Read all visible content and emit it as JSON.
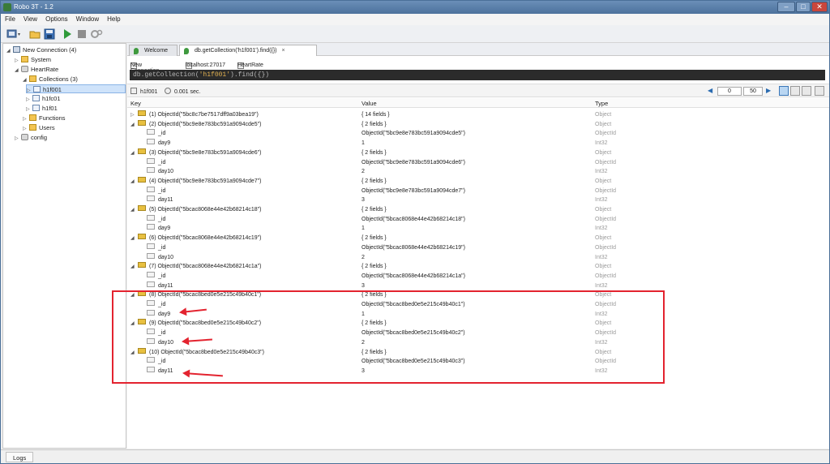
{
  "window": {
    "title": "Robo 3T - 1.2"
  },
  "menu": [
    "File",
    "View",
    "Options",
    "Window",
    "Help"
  ],
  "sidebar": {
    "items": [
      {
        "label": "New Connection (4)",
        "icon": "server-icon"
      },
      {
        "label": "System",
        "icon": "folder-icon"
      },
      {
        "label": "HeartRate",
        "icon": "database-icon"
      },
      {
        "label": "Collections (3)",
        "icon": "folder-icon"
      },
      {
        "label": "h1f001",
        "icon": "collection-icon"
      },
      {
        "label": "h1fc01",
        "icon": "collection-icon"
      },
      {
        "label": "h1f01",
        "icon": "collection-icon"
      },
      {
        "label": "Functions",
        "icon": "folder-icon"
      },
      {
        "label": "Users",
        "icon": "folder-icon"
      },
      {
        "label": "config",
        "icon": "database-icon"
      }
    ]
  },
  "tabs": [
    {
      "label": "Welcome"
    },
    {
      "label": "db.getCollection('h1f001').find({})",
      "close": "×"
    }
  ],
  "connection": {
    "name": "New Connection",
    "host": "localhost:27017",
    "db": "HeartRate"
  },
  "query": {
    "prefix": "db.getCollection(",
    "arg": "'h1f001'",
    "suffix": ").find({})"
  },
  "results": {
    "collection": "h1f001",
    "time": "0.001 sec.",
    "page_start": "0",
    "page_size": "50",
    "columns": {
      "key": "Key",
      "value": "Value",
      "type": "Type"
    },
    "rows": [
      {
        "level": 0,
        "expanded": false,
        "icon": "doc",
        "key": "(1) ObjectId(\"5bc8c7be7517dff9a03bea19\")",
        "value": "{ 14 fields }",
        "type": "Object"
      },
      {
        "level": 0,
        "expanded": true,
        "icon": "doc",
        "key": "(2) ObjectId(\"5bc9e8e783bc591a9094cde5\")",
        "value": "{ 2 fields }",
        "type": "Object"
      },
      {
        "level": 1,
        "icon": "oid",
        "key": "_id",
        "value": "ObjectId(\"5bc9e8e783bc591a9094cde5\")",
        "type": "ObjectId"
      },
      {
        "level": 1,
        "icon": "num",
        "key": "day9",
        "value": "1",
        "type": "Int32"
      },
      {
        "level": 0,
        "expanded": true,
        "icon": "doc",
        "key": "(3) ObjectId(\"5bc9e8e783bc591a9094cde6\")",
        "value": "{ 2 fields }",
        "type": "Object"
      },
      {
        "level": 1,
        "icon": "oid",
        "key": "_id",
        "value": "ObjectId(\"5bc9e8e783bc591a9094cde6\")",
        "type": "ObjectId"
      },
      {
        "level": 1,
        "icon": "num",
        "key": "day10",
        "value": "2",
        "type": "Int32"
      },
      {
        "level": 0,
        "expanded": true,
        "icon": "doc",
        "key": "(4) ObjectId(\"5bc9e8e783bc591a9094cde7\")",
        "value": "{ 2 fields }",
        "type": "Object"
      },
      {
        "level": 1,
        "icon": "oid",
        "key": "_id",
        "value": "ObjectId(\"5bc9e8e783bc591a9094cde7\")",
        "type": "ObjectId"
      },
      {
        "level": 1,
        "icon": "num",
        "key": "day11",
        "value": "3",
        "type": "Int32"
      },
      {
        "level": 0,
        "expanded": true,
        "icon": "doc",
        "key": "(5) ObjectId(\"5bcac8068e44e42b68214c18\")",
        "value": "{ 2 fields }",
        "type": "Object"
      },
      {
        "level": 1,
        "icon": "oid",
        "key": "_id",
        "value": "ObjectId(\"5bcac8068e44e42b68214c18\")",
        "type": "ObjectId"
      },
      {
        "level": 1,
        "icon": "num",
        "key": "day9",
        "value": "1",
        "type": "Int32"
      },
      {
        "level": 0,
        "expanded": true,
        "icon": "doc",
        "key": "(6) ObjectId(\"5bcac8068e44e42b68214c19\")",
        "value": "{ 2 fields }",
        "type": "Object"
      },
      {
        "level": 1,
        "icon": "oid",
        "key": "_id",
        "value": "ObjectId(\"5bcac8068e44e42b68214c19\")",
        "type": "ObjectId"
      },
      {
        "level": 1,
        "icon": "num",
        "key": "day10",
        "value": "2",
        "type": "Int32"
      },
      {
        "level": 0,
        "expanded": true,
        "icon": "doc",
        "key": "(7) ObjectId(\"5bcac8068e44e42b68214c1a\")",
        "value": "{ 2 fields }",
        "type": "Object"
      },
      {
        "level": 1,
        "icon": "oid",
        "key": "_id",
        "value": "ObjectId(\"5bcac8068e44e42b68214c1a\")",
        "type": "ObjectId"
      },
      {
        "level": 1,
        "icon": "num",
        "key": "day11",
        "value": "3",
        "type": "Int32"
      },
      {
        "level": 0,
        "expanded": true,
        "icon": "doc",
        "key": "(8) ObjectId(\"5bcac8bed0e5e215c49b40c1\")",
        "value": "{ 2 fields }",
        "type": "Object"
      },
      {
        "level": 1,
        "icon": "oid",
        "key": "_id",
        "value": "ObjectId(\"5bcac8bed0e5e215c49b40c1\")",
        "type": "ObjectId"
      },
      {
        "level": 1,
        "icon": "num",
        "key": "day9",
        "value": "1",
        "type": "Int32"
      },
      {
        "level": 0,
        "expanded": true,
        "icon": "doc",
        "key": "(9) ObjectId(\"5bcac8bed0e5e215c49b40c2\")",
        "value": "{ 2 fields }",
        "type": "Object"
      },
      {
        "level": 1,
        "icon": "oid",
        "key": "_id",
        "value": "ObjectId(\"5bcac8bed0e5e215c49b40c2\")",
        "type": "ObjectId"
      },
      {
        "level": 1,
        "icon": "num",
        "key": "day10",
        "value": "2",
        "type": "Int32"
      },
      {
        "level": 0,
        "expanded": true,
        "icon": "doc",
        "key": "(10) ObjectId(\"5bcac8bed0e5e215c49b40c3\")",
        "value": "{ 2 fields }",
        "type": "Object"
      },
      {
        "level": 1,
        "icon": "oid",
        "key": "_id",
        "value": "ObjectId(\"5bcac8bed0e5e215c49b40c3\")",
        "type": "ObjectId"
      },
      {
        "level": 1,
        "icon": "num",
        "key": "day11",
        "value": "3",
        "type": "Int32"
      }
    ]
  },
  "status": {
    "logs_tab": "Logs"
  },
  "colors": {
    "highlight": "#e3232f",
    "query_bg": "#2b2b2b",
    "accent": "#3b77b8"
  }
}
